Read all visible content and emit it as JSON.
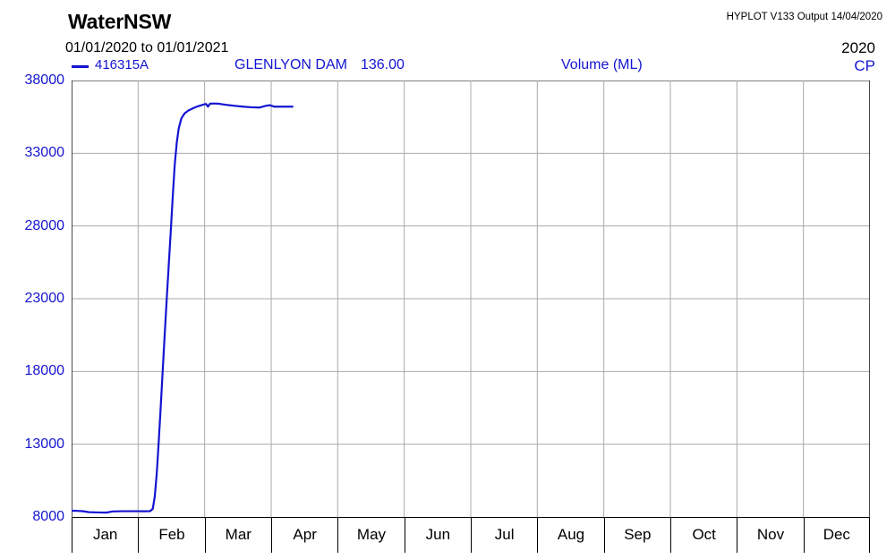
{
  "header": {
    "brand": "WaterNSW",
    "hyplot": "HYPLOT V133  Output 14/04/2020",
    "date_range": "01/01/2020  to  01/01/2021",
    "year": "2020"
  },
  "legend": {
    "line_marker": "line-marker-icon",
    "series_id": "416315A",
    "site_name": "GLENLYON DAM",
    "site_value": "136.00",
    "parameter": "Volume (ML)",
    "code": "CP",
    "line_color": "#1414d2"
  },
  "chart_data": {
    "type": "line",
    "title": "GLENLYON DAM 136.00 - Volume (ML)",
    "subtitle": "01/01/2020 to 01/01/2021",
    "xlabel": "",
    "ylabel": "Volume (ML)",
    "ylim": [
      8000,
      38000
    ],
    "yticks": [
      8000,
      13000,
      18000,
      23000,
      28000,
      33000,
      38000
    ],
    "ytick_labels": [
      "8000",
      "13000",
      "18000",
      "23000",
      "28000",
      "33000",
      "38000"
    ],
    "grid": true,
    "legend_position": "top",
    "xlim": [
      "2020-01-01",
      "2021-01-01"
    ],
    "categories": [
      "Jan",
      "Feb",
      "Mar",
      "Apr",
      "May",
      "Jun",
      "Jul",
      "Aug",
      "Sep",
      "Oct",
      "Nov",
      "Dec"
    ],
    "series": [
      {
        "name": "416315A",
        "color": "#1414d2",
        "units": "ML",
        "points": [
          {
            "x": 0.0,
            "y": 8430
          },
          {
            "x": 0.08,
            "y": 8420
          },
          {
            "x": 0.16,
            "y": 8400
          },
          {
            "x": 0.26,
            "y": 8330
          },
          {
            "x": 0.4,
            "y": 8310
          },
          {
            "x": 0.52,
            "y": 8300
          },
          {
            "x": 0.62,
            "y": 8380
          },
          {
            "x": 0.75,
            "y": 8395
          },
          {
            "x": 0.9,
            "y": 8395
          },
          {
            "x": 1.0,
            "y": 8395
          },
          {
            "x": 1.1,
            "y": 8390
          },
          {
            "x": 1.18,
            "y": 8400
          },
          {
            "x": 1.22,
            "y": 8560
          },
          {
            "x": 1.25,
            "y": 9400
          },
          {
            "x": 1.28,
            "y": 11000
          },
          {
            "x": 1.31,
            "y": 13200
          },
          {
            "x": 1.34,
            "y": 15600
          },
          {
            "x": 1.37,
            "y": 18100
          },
          {
            "x": 1.4,
            "y": 20600
          },
          {
            "x": 1.43,
            "y": 23000
          },
          {
            "x": 1.46,
            "y": 25300
          },
          {
            "x": 1.49,
            "y": 27600
          },
          {
            "x": 1.52,
            "y": 30000
          },
          {
            "x": 1.55,
            "y": 32200
          },
          {
            "x": 1.58,
            "y": 33700
          },
          {
            "x": 1.61,
            "y": 34700
          },
          {
            "x": 1.65,
            "y": 35400
          },
          {
            "x": 1.7,
            "y": 35750
          },
          {
            "x": 1.76,
            "y": 35950
          },
          {
            "x": 1.83,
            "y": 36100
          },
          {
            "x": 1.9,
            "y": 36230
          },
          {
            "x": 1.97,
            "y": 36330
          },
          {
            "x": 2.02,
            "y": 36390
          },
          {
            "x": 2.05,
            "y": 36200
          },
          {
            "x": 2.08,
            "y": 36400
          },
          {
            "x": 2.14,
            "y": 36420
          },
          {
            "x": 2.22,
            "y": 36400
          },
          {
            "x": 2.32,
            "y": 36330
          },
          {
            "x": 2.45,
            "y": 36260
          },
          {
            "x": 2.58,
            "y": 36200
          },
          {
            "x": 2.7,
            "y": 36160
          },
          {
            "x": 2.82,
            "y": 36140
          },
          {
            "x": 2.92,
            "y": 36260
          },
          {
            "x": 2.98,
            "y": 36300
          },
          {
            "x": 3.05,
            "y": 36200
          },
          {
            "x": 3.2,
            "y": 36200
          },
          {
            "x": 3.32,
            "y": 36200
          }
        ]
      }
    ]
  }
}
